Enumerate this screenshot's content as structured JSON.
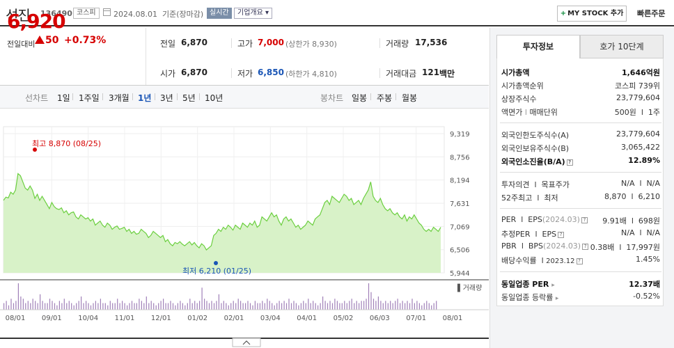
{
  "header": {
    "name": "선진",
    "code": "136490",
    "market": "코스피",
    "date_text": "2024.08.01  기준(장마감)",
    "realtime": "실시간",
    "company_overview": "기업개요",
    "mystock_label": "MY STOCK 추가",
    "quick_order": "빠른주문"
  },
  "price": {
    "current": "6,920",
    "diff_label": "전일대비",
    "diff": "50",
    "diff_pct": "+0.73%",
    "color_up": "#d60000"
  },
  "stats": {
    "prev_label": "전일",
    "prev": "6,870",
    "high_label": "고가",
    "high": "7,000",
    "upper_limit": "(상한가 8,930)",
    "volume_label": "거래량",
    "volume": "17,536",
    "open_label": "시가",
    "open": "6,870",
    "low_label": "저가",
    "low": "6,850",
    "lower_limit": "(하한가 4,810)",
    "amount_label": "거래대금",
    "amount": "121",
    "amount_unit": "백만"
  },
  "periods": {
    "line_label": "선차트",
    "line": [
      "1일",
      "1주일",
      "3개월",
      "1년",
      "3년",
      "5년",
      "10년"
    ],
    "selected": "1년",
    "candle_label": "봉차트",
    "candle": [
      "일봉",
      "주봉",
      "월봉"
    ]
  },
  "chart_data": {
    "type": "area",
    "x_ticks": [
      "08/01",
      "09/01",
      "10/04",
      "11/01",
      "12/01",
      "01/02",
      "02/01",
      "03/04",
      "04/01",
      "05/02",
      "06/03",
      "07/01",
      "08/01"
    ],
    "y_ticks": [
      9319,
      8756,
      8194,
      7631,
      7069,
      6506,
      5944
    ],
    "ylim": [
      5944,
      9319
    ],
    "high_label": "최고 8,870 (08/25)",
    "low_label": "최저 6,210 (01/25)",
    "volume_label": "거래량",
    "line_color": "#6bcf3f",
    "fill_color": "#d8f2c8",
    "values": [
      7700,
      7780,
      7760,
      7900,
      7850,
      7950,
      8350,
      8300,
      8150,
      8000,
      7950,
      8050,
      7950,
      7750,
      7850,
      7700,
      7800,
      7700,
      7600,
      7500,
      7650,
      7550,
      7500,
      7480,
      7520,
      7400,
      7450,
      7350,
      7400,
      7420,
      7300,
      7250,
      7350,
      7300,
      7250,
      7280,
      7200,
      7250,
      7100,
      7150,
      7200,
      7100,
      7050,
      7150,
      7100,
      7000,
      7050,
      7080,
      7000,
      7020,
      7050,
      6950,
      7000,
      6900,
      6950,
      6880,
      6900,
      7000,
      6950,
      6900,
      6800,
      6850,
      6950,
      6900,
      6850,
      6800,
      6850,
      6700,
      6750,
      6650,
      6600,
      6680,
      6650,
      6700,
      6640,
      6600,
      6650,
      6700,
      6620,
      6680,
      6600,
      6550,
      6650,
      6600,
      6500,
      6550,
      6600,
      6850,
      6900,
      7000,
      6950,
      7050,
      7000,
      7100,
      7050,
      6980,
      7100,
      7050,
      7000,
      7150,
      7100,
      7050,
      7150,
      7100,
      7200,
      7050,
      7100,
      7300,
      7250,
      7200,
      7300,
      7400,
      7300,
      7350,
      7200,
      7100,
      7250,
      7300,
      7200,
      7250,
      7150,
      7050,
      7100,
      7000,
      7050,
      7100,
      7200,
      7150,
      7100,
      7250,
      7300,
      7350,
      7500,
      7650,
      7700,
      7600,
      7800,
      7750,
      7700,
      7650,
      7750,
      7850,
      7800,
      7700,
      7750,
      7600,
      7650,
      7700,
      7600,
      7750,
      7850,
      7950,
      8150,
      7800,
      7700,
      7650,
      7750,
      7600,
      7500,
      7450,
      7500,
      7400,
      7350,
      7400,
      7300,
      7250,
      7350,
      7200,
      7300,
      7250,
      7350,
      7250,
      7150,
      7100,
      7000,
      6950,
      7000,
      6950,
      7050,
      7000,
      6950,
      7050
    ],
    "volume": [
      3,
      4,
      2,
      5,
      3,
      4,
      12,
      6,
      5,
      3,
      4,
      3,
      5,
      4,
      3,
      7,
      4,
      3,
      3,
      5,
      4,
      3,
      2,
      4,
      3,
      5,
      3,
      4,
      3,
      2,
      3,
      4,
      6,
      3,
      4,
      3,
      2,
      3,
      4,
      3,
      5,
      3,
      3,
      2,
      4,
      3,
      3,
      5,
      3,
      4,
      3,
      2,
      3,
      4,
      3,
      3,
      5,
      4,
      3,
      6,
      3,
      4,
      3,
      2,
      3,
      4,
      5,
      3,
      3,
      4,
      3,
      2,
      3,
      4,
      3,
      2,
      3,
      5,
      3,
      4,
      3,
      4,
      10,
      5,
      4,
      3,
      4,
      3,
      4,
      7,
      3,
      4,
      3,
      2,
      3,
      4,
      3,
      5,
      4,
      3,
      3,
      4,
      3,
      2,
      4,
      3,
      3,
      4,
      3,
      5,
      4,
      3,
      2,
      3,
      4,
      3,
      4,
      3,
      5,
      3,
      4,
      3,
      2,
      3,
      4,
      3,
      5,
      3,
      4,
      3,
      2,
      3,
      6,
      4,
      3,
      4,
      3,
      5,
      4,
      3,
      3,
      4,
      3,
      4,
      5,
      3,
      4,
      3,
      4,
      4,
      5,
      12,
      8,
      5,
      4,
      6,
      4,
      3,
      4,
      3,
      4,
      3,
      4,
      5,
      3,
      4,
      3,
      4,
      3,
      5,
      3,
      4,
      3,
      2,
      3,
      4,
      3,
      2,
      3,
      4
    ]
  },
  "tabs": {
    "invest": "투자정보",
    "orderbook": "호가 10단계"
  },
  "info": {
    "market_cap_label": "시가총액",
    "market_cap": "1,646억원",
    "cap_rank_label": "시가총액순위",
    "cap_rank": "코스피 739위",
    "shares_label": "상장주식수",
    "shares": "23,779,604",
    "par_label": "액면가",
    "par_sep": "l",
    "unit_label": "매매단위",
    "par_unit": "500원  l  1주",
    "foreign_limit_label": "외국인한도주식수(A)",
    "foreign_limit": "23,779,604",
    "foreign_hold_label": "외국인보유주식수(B)",
    "foreign_hold": "3,065,422",
    "foreign_ratio_label": "외국인소진율(B/A)",
    "foreign_ratio": "12.89%",
    "opinion_label": "투자의견  l  목표주가",
    "opinion": "N/A  l  N/A",
    "week52_label": "52주최고  l  최저",
    "week52": "8,870  l  6,210",
    "per_label": "PER  l  EPS",
    "per_period": "(2024.03)",
    "per": "9.91배  l  698원",
    "est_per_label": "추정PER  l  EPS",
    "est_per": "N/A  l  N/A",
    "pbr_label": "PBR  l  BPS",
    "pbr_period": "(2024.03)",
    "pbr": "0.38배  l  17,997원",
    "div_label": "배당수익률  l",
    "div_period": "2023.12",
    "div": "1.45%",
    "sector_per_label": "동일업종 PER",
    "sector_per": "12.37배",
    "sector_chg_label": "동일업종 등락률",
    "sector_chg": "-0.52%"
  },
  "icons": {
    "calendar": "calendar-icon",
    "up_triangle": "up-triangle-icon",
    "help": "help-icon",
    "collapse": "chevron-up-icon"
  }
}
